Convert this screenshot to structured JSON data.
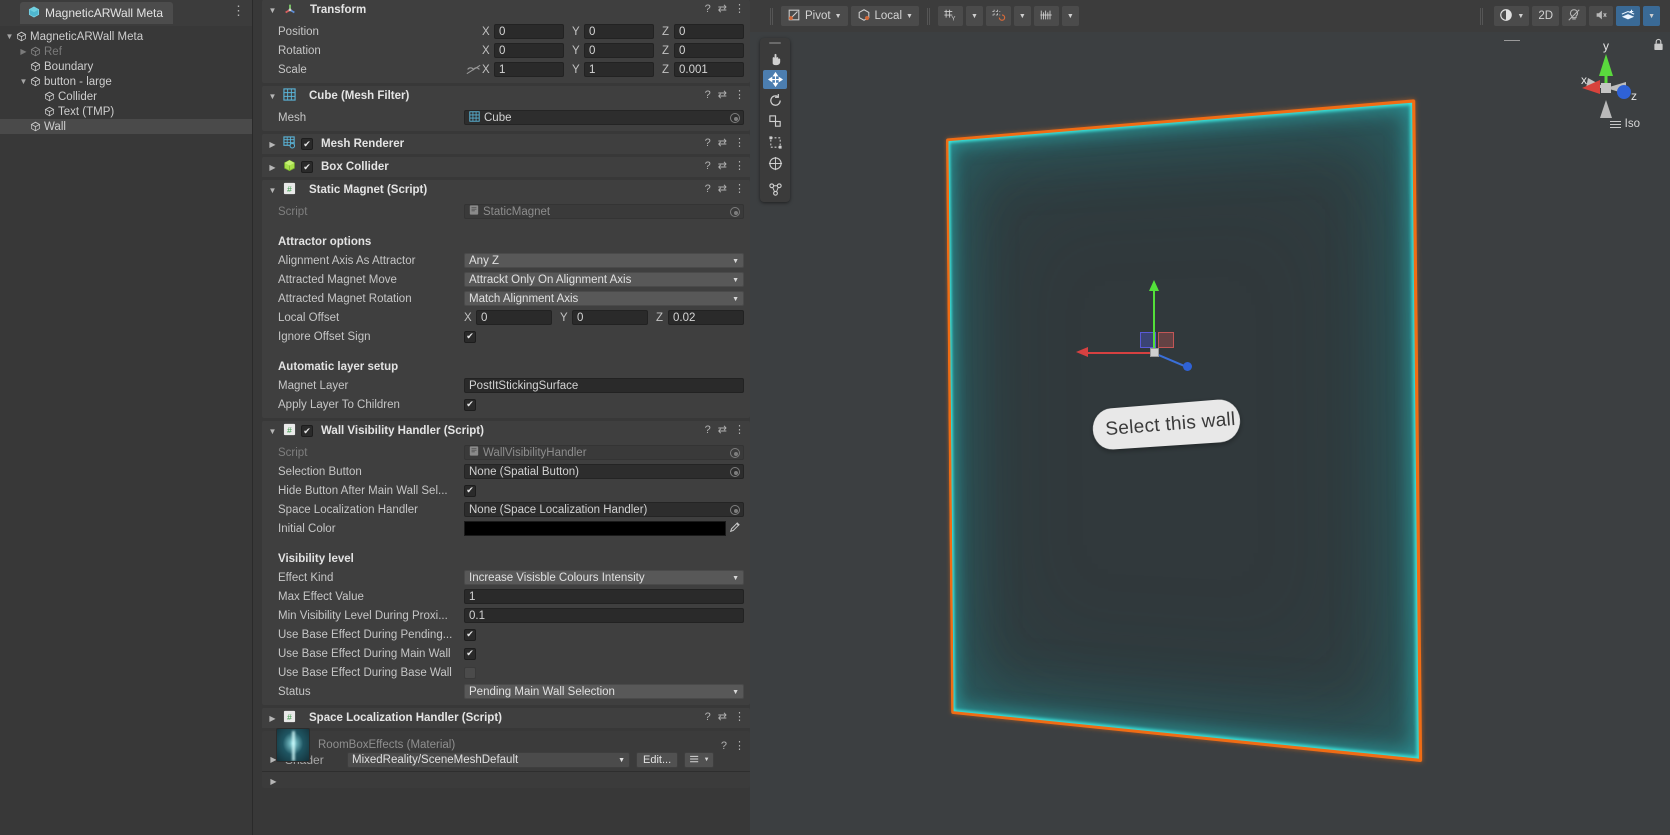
{
  "hierarchy": {
    "tab_label": "MagneticARWall Meta",
    "kebab": "⋮",
    "items": [
      {
        "label": "MagneticARWall Meta",
        "arrow": "▼",
        "depth": 0,
        "dim": false,
        "selected": false
      },
      {
        "label": "Ref",
        "arrow": "▶",
        "depth": 1,
        "dim": true,
        "selected": false
      },
      {
        "label": "Boundary",
        "arrow": "",
        "depth": 1,
        "dim": false,
        "selected": false
      },
      {
        "label": "button - large",
        "arrow": "▼",
        "depth": 1,
        "dim": false,
        "selected": false
      },
      {
        "label": "Collider",
        "arrow": "",
        "depth": 2,
        "dim": false,
        "selected": false
      },
      {
        "label": "Text (TMP)",
        "arrow": "",
        "depth": 2,
        "dim": false,
        "selected": false
      },
      {
        "label": "Wall",
        "arrow": "",
        "depth": 1,
        "dim": false,
        "selected": true
      }
    ]
  },
  "inspector": {
    "transform": {
      "title": "Transform",
      "position_label": "Position",
      "rotation_label": "Rotation",
      "scale_label": "Scale",
      "axes": [
        "X",
        "Y",
        "Z"
      ],
      "position": [
        "0",
        "0",
        "0"
      ],
      "rotation": [
        "0",
        "0",
        "0"
      ],
      "scale": [
        "1",
        "1",
        "0.001"
      ]
    },
    "mesh_filter": {
      "title": "Cube (Mesh Filter)",
      "mesh_label": "Mesh",
      "mesh_value": "Cube"
    },
    "mesh_renderer": {
      "title": "Mesh Renderer",
      "enabled": true
    },
    "box_collider": {
      "title": "Box Collider",
      "enabled": true
    },
    "static_magnet": {
      "title": "Static Magnet (Script)",
      "script_label": "Script",
      "script_value": "StaticMagnet",
      "attractor_header": "Attractor options",
      "alignment_axis_label": "Alignment Axis As Attractor",
      "alignment_axis_value": "Any Z",
      "magnet_move_label": "Attracted Magnet Move",
      "magnet_move_value": "Attrackt Only On Alignment Axis",
      "magnet_rotation_label": "Attracted Magnet Rotation",
      "magnet_rotation_value": "Match Alignment Axis",
      "local_offset_label": "Local Offset",
      "local_offset": [
        "0",
        "0",
        "0.02"
      ],
      "ignore_offset_label": "Ignore Offset Sign",
      "ignore_offset_checked": true,
      "layer_header": "Automatic layer setup",
      "magnet_layer_label": "Magnet Layer",
      "magnet_layer_value": "PostItStickingSurface",
      "apply_layer_label": "Apply Layer To Children",
      "apply_layer_checked": true
    },
    "wall_visibility": {
      "title": "Wall Visibility Handler (Script)",
      "enabled": true,
      "script_label": "Script",
      "script_value": "WallVisibilityHandler",
      "selection_button_label": "Selection Button",
      "selection_button_value": "None (Spatial Button)",
      "hide_button_label": "Hide Button After Main Wall Sel...",
      "hide_button_checked": true,
      "space_loc_label": "Space Localization Handler",
      "space_loc_value": "None (Space Localization Handler)",
      "initial_color_label": "Initial Color",
      "initial_color_value": "#000000",
      "visibility_header": "Visibility level",
      "effect_kind_label": "Effect Kind",
      "effect_kind_value": "Increase Visisble Colours Intensity",
      "max_effect_label": "Max Effect Value",
      "max_effect_value": "1",
      "min_visibility_label": "Min Visibility Level During Proxi...",
      "min_visibility_value": "0.1",
      "base_pending_label": "Use Base Effect During Pending...",
      "base_pending_checked": true,
      "base_main_label": "Use Base Effect During Main Wall",
      "base_main_checked": true,
      "base_base_label": "Use Base Effect During Base Wall",
      "base_base_checked": false,
      "status_label": "Status",
      "status_value": "Pending Main Wall Selection"
    },
    "space_localization": {
      "title": "Space Localization Handler (Script)"
    },
    "material": {
      "title": "RoomBoxEffects (Material)",
      "shader_label": "Shader",
      "shader_value": "MixedReality/SceneMeshDefault",
      "edit_button": "Edit..."
    }
  },
  "scene": {
    "toolbar": {
      "pivot_label": "Pivot",
      "space_label": "Local",
      "two_d_label": "2D",
      "grid_icon": "grid-snap-icon",
      "snap_icon": "snap-increment-icon",
      "rulers_icon": "grid-rulers-icon",
      "shading_icon": "shading-mode-icon",
      "lighting_icon": "scene-lighting-icon",
      "audio_icon": "scene-audio-icon",
      "fx_icon": "scene-effects-icon"
    },
    "tools": [
      {
        "name": "hand-tool",
        "glyph": "✋",
        "selected": false
      },
      {
        "name": "move-tool",
        "glyph": "move",
        "selected": true
      },
      {
        "name": "rotate-tool",
        "glyph": "rotate",
        "selected": false
      },
      {
        "name": "scale-tool",
        "glyph": "scale",
        "selected": false
      },
      {
        "name": "rect-tool",
        "glyph": "rect",
        "selected": false
      },
      {
        "name": "transform-tool",
        "glyph": "transform",
        "selected": false
      },
      {
        "name": "custom-tool",
        "glyph": "custom",
        "selected": false
      }
    ],
    "gizmo": {
      "axis_x": "x",
      "axis_y": "y",
      "axis_z": "z",
      "projection_label": "Iso",
      "lock_icon": "lock-icon"
    },
    "wall": {
      "button_label": "Select this wall",
      "selection_outline_color": "#f06c14",
      "glow_color": "#3cebe1"
    }
  }
}
